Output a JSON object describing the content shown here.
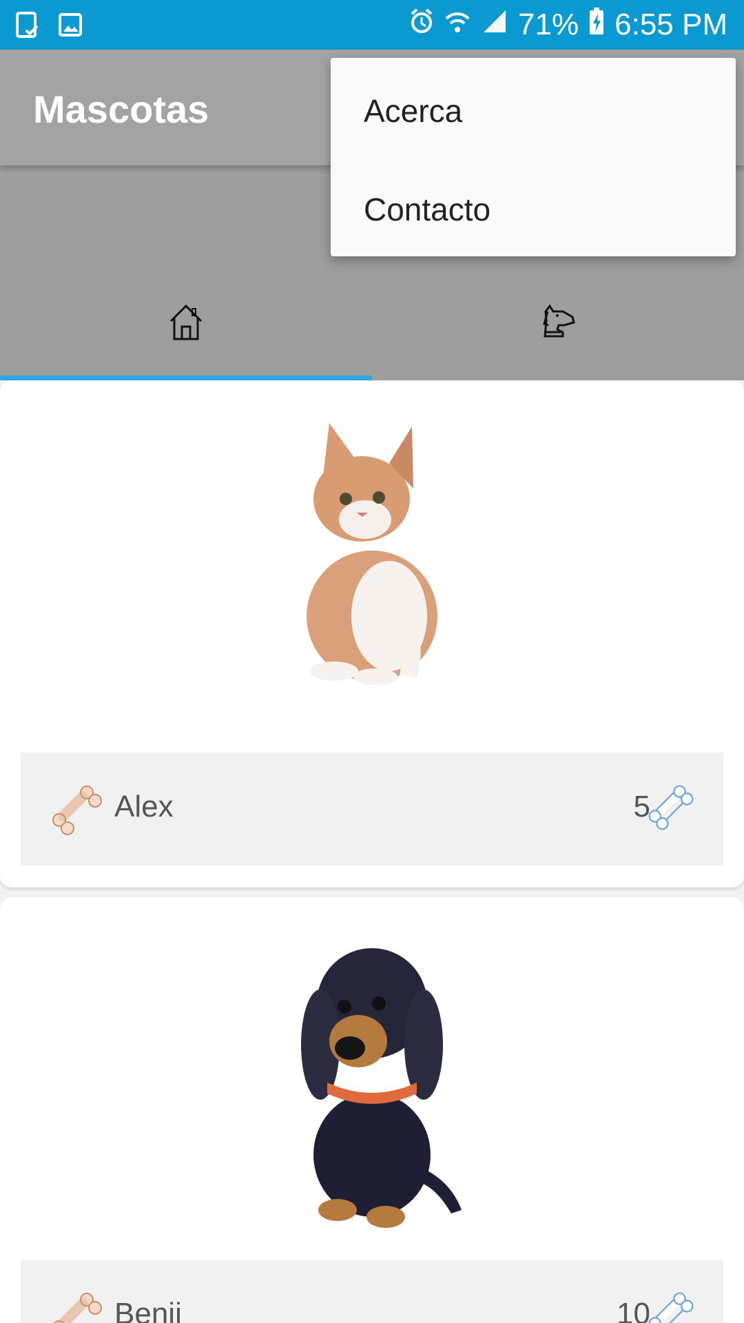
{
  "status_bar": {
    "battery_percent": "71%",
    "time": "6:55 PM",
    "icons": [
      "tablet-check-icon",
      "image-icon",
      "alarm-icon",
      "wifi-icon",
      "signal-icon",
      "battery-charging-icon"
    ]
  },
  "app_bar": {
    "title": "Mascotas",
    "color": "#a3a3a3"
  },
  "tabs": [
    {
      "icon": "home-icon",
      "selected": true
    },
    {
      "icon": "dog-icon",
      "selected": false
    }
  ],
  "accent_color": "#29a8e0",
  "menu": {
    "items": [
      {
        "label": "Acerca"
      },
      {
        "label": "Contacto"
      }
    ]
  },
  "pets": [
    {
      "name": "Alex",
      "score": "5",
      "photo": "kitten-photo"
    },
    {
      "name": "Benji",
      "score": "10",
      "photo": "dachshund-photo"
    }
  ]
}
